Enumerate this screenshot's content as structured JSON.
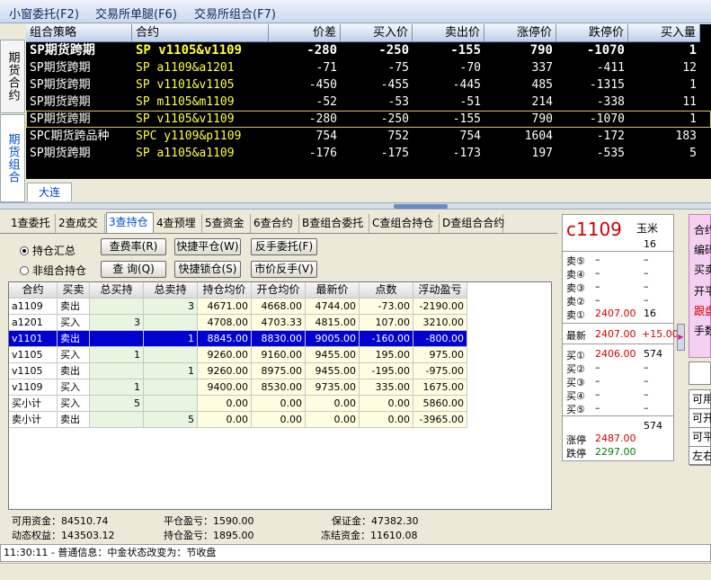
{
  "menu": [
    "小窗委托(F2)",
    "交易所单腿(F6)",
    "交易所组合(F7)"
  ],
  "side_tabs": {
    "futures_contract": "期货合约",
    "futures_combo": "期货组合"
  },
  "quote_grid": {
    "headers": [
      "组合策略",
      "合约",
      "价差",
      "买入价",
      "卖出价",
      "涨停价",
      "跌停价",
      "买入量"
    ],
    "rows": [
      {
        "strategy": "SP期货跨期",
        "contract": "SP v1105&v1109",
        "spread": "-280",
        "bid": "-250",
        "ask": "-155",
        "up_limit": "790",
        "down_limit": "-1070",
        "bid_vol": "1",
        "bold": true
      },
      {
        "strategy": "SP期货跨期",
        "contract": "SP a1109&a1201",
        "spread": "-71",
        "bid": "-75",
        "ask": "-70",
        "up_limit": "337",
        "down_limit": "-411",
        "bid_vol": "12"
      },
      {
        "strategy": "SP期货跨期",
        "contract": "SP v1101&v1105",
        "spread": "-450",
        "bid": "-455",
        "ask": "-445",
        "up_limit": "485",
        "down_limit": "-1315",
        "bid_vol": "1"
      },
      {
        "strategy": "SP期货跨期",
        "contract": "SP m1105&m1109",
        "spread": "-52",
        "bid": "-53",
        "ask": "-51",
        "up_limit": "214",
        "down_limit": "-338",
        "bid_vol": "11"
      },
      {
        "strategy": "SP期货跨期",
        "contract": "SP v1105&v1109",
        "spread": "-280",
        "bid": "-250",
        "ask": "-155",
        "up_limit": "790",
        "down_limit": "-1070",
        "bid_vol": "1",
        "selected": true
      },
      {
        "strategy": "SPC期货跨品种",
        "contract": "SPC y1109&p1109",
        "spread": "754",
        "bid": "752",
        "ask": "754",
        "up_limit": "1604",
        "down_limit": "-172",
        "bid_vol": "183"
      },
      {
        "strategy": "SP期货跨期",
        "contract": "SP a1105&a1109",
        "spread": "-176",
        "bid": "-175",
        "ask": "-173",
        "up_limit": "197",
        "down_limit": "-535",
        "bid_vol": "5"
      }
    ]
  },
  "market_tab": "大连",
  "func_tabs": [
    "1查委托",
    "2查成交",
    "3查持仓",
    "4查预埋",
    "5查资金",
    "6查合约",
    "B查组合委托",
    "C查组合持仓",
    "D查组合合约"
  ],
  "active_func_tab": 2,
  "radios": {
    "summary": "持仓汇总",
    "non_combo": "非组合持仓"
  },
  "buttons": {
    "fee_rate": "查费率(R)",
    "quick_close": "快捷平仓(W)",
    "reverse_order": "反手委托(F)",
    "query": "查 询(Q)",
    "quick_lock": "快捷锁仓(S)",
    "market_reverse": "市价反手(V)"
  },
  "positions": {
    "headers": [
      "合约",
      "买卖",
      "总买持",
      "总卖持",
      "持仓均价",
      "开仓均价",
      "最新价",
      "点数",
      "浮动盈亏"
    ],
    "rows": [
      {
        "c": [
          "a1109",
          "卖出",
          "",
          "3",
          "4671.00",
          "4668.00",
          "4744.00",
          "-73.00",
          "-2190.00"
        ]
      },
      {
        "c": [
          "a1201",
          "买入",
          "3",
          "",
          "4708.00",
          "4703.33",
          "4815.00",
          "107.00",
          "3210.00"
        ]
      },
      {
        "c": [
          "v1101",
          "卖出",
          "",
          "1",
          "8845.00",
          "8830.00",
          "9005.00",
          "-160.00",
          "-800.00"
        ],
        "highlight": true
      },
      {
        "c": [
          "v1105",
          "买入",
          "1",
          "",
          "9260.00",
          "9160.00",
          "9455.00",
          "195.00",
          "975.00"
        ]
      },
      {
        "c": [
          "v1105",
          "卖出",
          "",
          "1",
          "9260.00",
          "8975.00",
          "9455.00",
          "-195.00",
          "-975.00"
        ]
      },
      {
        "c": [
          "v1109",
          "买入",
          "1",
          "",
          "9400.00",
          "8530.00",
          "9735.00",
          "335.00",
          "1675.00"
        ]
      },
      {
        "c": [
          "买小计",
          "买入",
          "5",
          "",
          "0.00",
          "0.00",
          "0.00",
          "0.00",
          "5860.00"
        ]
      },
      {
        "c": [
          "卖小计",
          "卖出",
          "",
          "5",
          "0.00",
          "0.00",
          "0.00",
          "0.00",
          "-3965.00"
        ]
      }
    ]
  },
  "funds": {
    "available": "可用资金：84510.74",
    "dynamic_equity": "动态权益：143503.12",
    "close_pl": "平仓盈亏：1590.00",
    "position_pl": "持仓盈亏：1895.00",
    "margin": "保证金：47382.30",
    "frozen": "冻结资金：11610.08"
  },
  "message": "11:30:11 - 普通信息：中金状态改变为：节收盘",
  "quote": {
    "contract": "c1109",
    "name": "玉米",
    "name_vol": "16",
    "asks": [
      {
        "label": "卖⑤",
        "price": "–",
        "vol": "–"
      },
      {
        "label": "卖④",
        "price": "–",
        "vol": "–"
      },
      {
        "label": "卖③",
        "price": "–",
        "vol": "–"
      },
      {
        "label": "卖②",
        "price": "–",
        "vol": "–"
      },
      {
        "label": "卖①",
        "price": "2407.00",
        "vol": "16"
      }
    ],
    "last_label": "最新",
    "last_price": "2407.00",
    "last_change": "+15.00",
    "bids": [
      {
        "label": "买①",
        "price": "2406.00",
        "vol": "574"
      },
      {
        "label": "买②",
        "price": "–",
        "vol": "–"
      },
      {
        "label": "买③",
        "price": "–",
        "vol": "–"
      },
      {
        "label": "买④",
        "price": "–",
        "vol": "–"
      },
      {
        "label": "买⑤",
        "price": "–",
        "vol": "–"
      }
    ],
    "total_vol": "574",
    "up_limit_label": "涨停",
    "up_limit": "2487.00",
    "down_limit_label": "跌停",
    "down_limit": "2297.00"
  },
  "right_panel": {
    "lines": [
      "合约",
      "编码",
      "买卖",
      "开平",
      "跟盘",
      "手数"
    ],
    "rows": [
      "可用",
      "可开",
      "可平",
      "左右"
    ]
  },
  "colors": {
    "quote_bg": "#000000",
    "contract_yellow": "#ffff40",
    "highlight_blue": "#0000d0",
    "price_red": "#d00000",
    "price_green": "#008000"
  }
}
